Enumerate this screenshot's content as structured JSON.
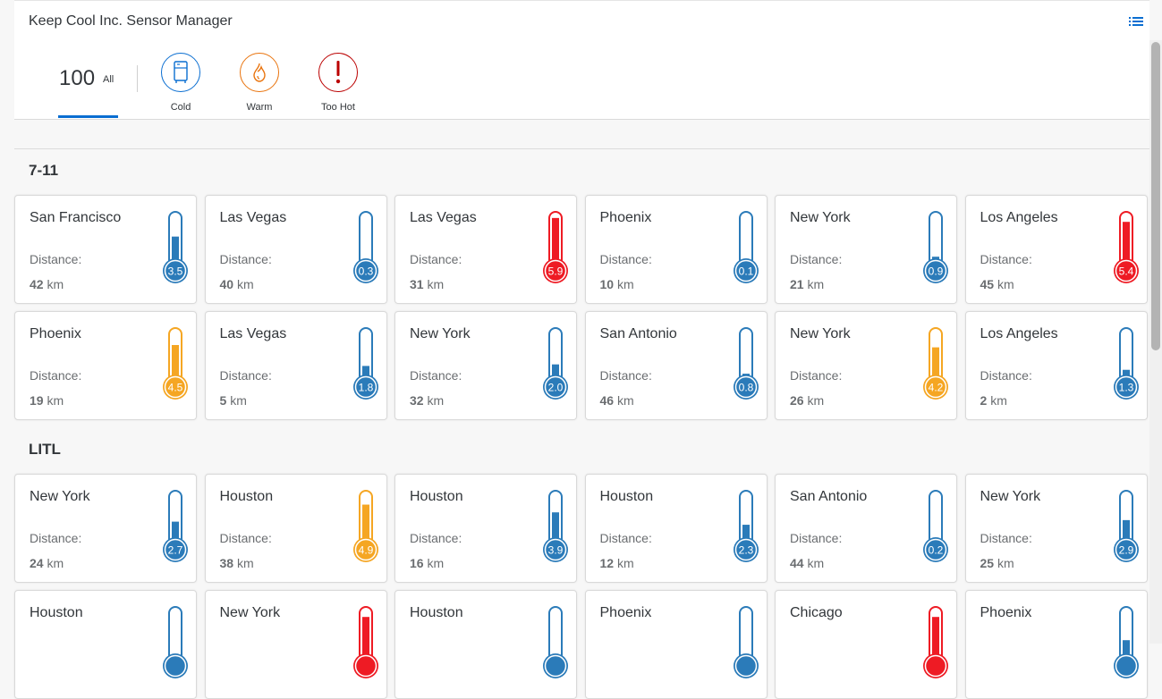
{
  "header": {
    "title": "Keep Cool Inc. Sensor Manager",
    "menu_icon": "list-icon"
  },
  "filter_tabs": {
    "all": {
      "count": "100",
      "label": "All"
    },
    "cold": {
      "label": "Cold",
      "icon": "fridge-icon",
      "color": "#0a6ed1"
    },
    "warm": {
      "label": "Warm",
      "icon": "flame-icon",
      "color": "#e9730c"
    },
    "hot": {
      "label": "Too Hot",
      "icon": "exclamation-icon",
      "color": "#bb0000"
    }
  },
  "colors": {
    "cold": "#2b7bb9",
    "warm": "#f5a623",
    "hot": "#ee1b24"
  },
  "distance_label": "Distance:",
  "distance_unit": "km",
  "groups": [
    {
      "title": "7-11",
      "sensors": [
        {
          "city": "San Francisco",
          "distance": "42",
          "temp": "3.5",
          "status": "cold"
        },
        {
          "city": "Las Vegas",
          "distance": "40",
          "temp": "0.3",
          "status": "cold"
        },
        {
          "city": "Las Vegas",
          "distance": "31",
          "temp": "5.9",
          "status": "hot"
        },
        {
          "city": "Phoenix",
          "distance": "10",
          "temp": "0.1",
          "status": "cold"
        },
        {
          "city": "New York",
          "distance": "21",
          "temp": "0.9",
          "status": "cold"
        },
        {
          "city": "Los Angeles",
          "distance": "45",
          "temp": "5.4",
          "status": "hot"
        },
        {
          "city": "Phoenix",
          "distance": "19",
          "temp": "4.5",
          "status": "warm"
        },
        {
          "city": "Las Vegas",
          "distance": "5",
          "temp": "1.8",
          "status": "cold"
        },
        {
          "city": "New York",
          "distance": "32",
          "temp": "2.0",
          "status": "cold"
        },
        {
          "city": "San Antonio",
          "distance": "46",
          "temp": "0.8",
          "status": "cold"
        },
        {
          "city": "New York",
          "distance": "26",
          "temp": "4.2",
          "status": "warm"
        },
        {
          "city": "Los Angeles",
          "distance": "2",
          "temp": "1.3",
          "status": "cold"
        }
      ]
    },
    {
      "title": "LITL",
      "sensors": [
        {
          "city": "New York",
          "distance": "24",
          "temp": "2.7",
          "status": "cold"
        },
        {
          "city": "Houston",
          "distance": "38",
          "temp": "4.9",
          "status": "warm"
        },
        {
          "city": "Houston",
          "distance": "16",
          "temp": "3.9",
          "status": "cold"
        },
        {
          "city": "Houston",
          "distance": "12",
          "temp": "2.3",
          "status": "cold"
        },
        {
          "city": "San Antonio",
          "distance": "44",
          "temp": "0.2",
          "status": "cold"
        },
        {
          "city": "New York",
          "distance": "25",
          "temp": "2.9",
          "status": "cold"
        },
        {
          "city": "Houston",
          "distance": "",
          "temp": "",
          "status": "cold",
          "level": 0.1
        },
        {
          "city": "New York",
          "distance": "",
          "temp": "",
          "status": "hot",
          "level": 0.9
        },
        {
          "city": "Houston",
          "distance": "",
          "temp": "",
          "status": "cold",
          "level": 0
        },
        {
          "city": "Phoenix",
          "distance": "",
          "temp": "",
          "status": "cold",
          "level": 0
        },
        {
          "city": "Chicago",
          "distance": "",
          "temp": "",
          "status": "hot",
          "level": 0.9
        },
        {
          "city": "Phoenix",
          "distance": "",
          "temp": "",
          "status": "cold",
          "level": 0.4
        }
      ]
    }
  ]
}
